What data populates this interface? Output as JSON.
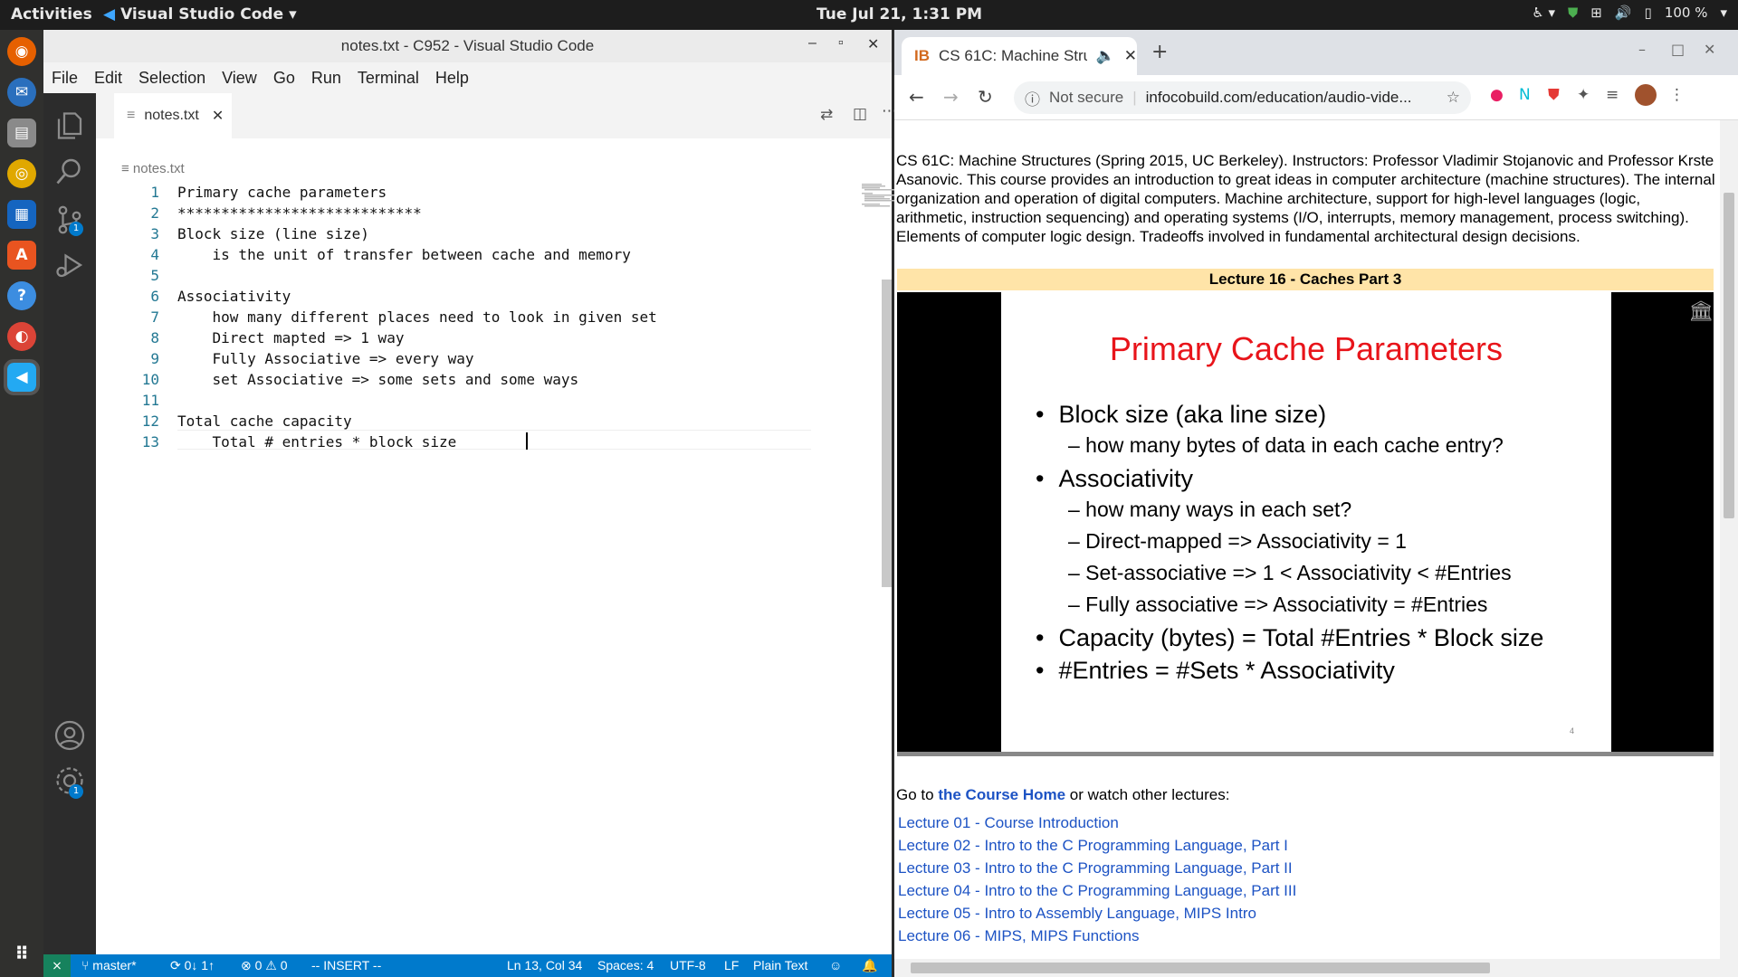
{
  "topbar": {
    "activities": "Activities",
    "app_name": "Visual Studio Code",
    "clock": "Tue Jul 21,  1:31 PM",
    "battery": "100 %"
  },
  "dock": {
    "icons": [
      "firefox-icon",
      "thunderbird-icon",
      "files-icon",
      "rhythmbox-icon",
      "writer-icon",
      "software-icon",
      "help-icon",
      "chrome-icon",
      "vscode-icon",
      "apps-grid-icon"
    ]
  },
  "vscode": {
    "window_title": "notes.txt - C952 - Visual Studio Code",
    "menu": [
      "File",
      "Edit",
      "Selection",
      "View",
      "Go",
      "Run",
      "Terminal",
      "Help"
    ],
    "tab_label": "notes.txt",
    "breadcrumb": "notes.txt",
    "source_control_badge": "1",
    "settings_badge": "1",
    "lines": [
      "Primary cache parameters",
      "****************************",
      "Block size (line size)",
      "    is the unit of transfer between cache and memory",
      "",
      "Associativity",
      "    how many different places need to look in given set",
      "    Direct mapted => 1 way",
      "    Fully Associative => every way",
      "    set Associative => some sets and some ways",
      "",
      "Total cache capacity",
      "    Total # entries * block size "
    ],
    "line_numbers": [
      "1",
      "2",
      "3",
      "4",
      "5",
      "6",
      "7",
      "8",
      "9",
      "10",
      "11",
      "12",
      "13"
    ],
    "status": {
      "branch": "master*",
      "sync": "0↓ 1↑",
      "problems": "0",
      "warnings": "0",
      "mode": "-- INSERT --",
      "position": "Ln 13, Col 34",
      "spaces": "Spaces: 4",
      "encoding": "UTF-8",
      "eol": "LF",
      "language": "Plain Text"
    }
  },
  "chrome": {
    "tab_title": "CS 61C: Machine Struc",
    "security": "Not secure",
    "url": "infocobuild.com/education/audio-vide...",
    "description": "CS 61C: Machine Structures (Spring 2015, UC Berkeley). Instructors: Professor Vladimir Stojanovic and Professor Krste Asanovic. This course provides an introduction to great ideas in computer architecture (machine structures). The internal organization and operation of digital computers. Machine architecture, support for high-level languages (logic, arithmetic, instruction sequencing) and operating systems (I/O, interrupts, memory management, process switching). Elements of computer logic design. Tradeoffs involved in fundamental architectural design decisions.",
    "lecture_bar": "Lecture 16 - Caches Part 3",
    "slide": {
      "title": "Primary Cache Parameters",
      "items": [
        {
          "level": 1,
          "text": "Block size (aka line size)"
        },
        {
          "level": 2,
          "text": "– how many bytes of data in each cache entry?"
        },
        {
          "level": 1,
          "text": "Associativity"
        },
        {
          "level": 2,
          "text": "– how many ways in each set?"
        },
        {
          "level": 2,
          "text": "– Direct-mapped => Associativity = 1"
        },
        {
          "level": 2,
          "text": "– Set-associative => 1 < Associativity < #Entries"
        },
        {
          "level": 2,
          "text": "– Fully associative => Associativity = #Entries"
        },
        {
          "level": 1,
          "text": "Capacity (bytes) = Total #Entries * Block size"
        },
        {
          "level": 1,
          "text": "#Entries = #Sets * Associativity"
        }
      ],
      "page_number": "4"
    },
    "goto_prefix": "Go to ",
    "goto_link": "the Course Home",
    "goto_suffix": " or watch other lectures:",
    "lectures": [
      "Lecture 01 - Course Introduction",
      "Lecture 02 - Intro to the C Programming Language, Part I",
      "Lecture 03 - Intro to the C Programming Language, Part II",
      "Lecture 04 - Intro to the C Programming Language, Part III",
      "Lecture 05 - Intro to Assembly Language, MIPS Intro",
      "Lecture 06 - MIPS, MIPS Functions"
    ]
  },
  "colors": {
    "vscode_blue": "#007acc",
    "slide_title_red": "#e8141a",
    "link_blue": "#1d53c4",
    "lecture_bar": "#ffe4a8"
  }
}
